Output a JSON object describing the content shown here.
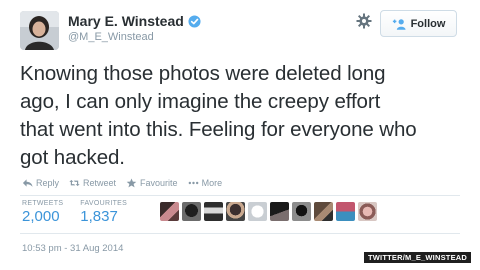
{
  "profile": {
    "display_name": "Mary E. Winstead",
    "handle": "@M_E_Winstead",
    "verified": true
  },
  "follow_button": {
    "label": "Follow"
  },
  "tweet": {
    "text_lines": [
      "Knowing those photos were deleted long",
      "ago, I can only imagine the creepy effort",
      "that went into this. Feeling for everyone who",
      "got hacked."
    ]
  },
  "actions": {
    "reply": "Reply",
    "retweet": "Retweet",
    "favourite": "Favourite",
    "more": "More"
  },
  "stats": {
    "retweets_label": "RETWEETS",
    "retweets_value": "2,000",
    "favourites_label": "FAVOURITES",
    "favourites_value": "1,837"
  },
  "favouriter_avatars": [
    "avatar-1",
    "avatar-2",
    "avatar-3",
    "avatar-4",
    "avatar-5",
    "avatar-6",
    "avatar-7",
    "avatar-8",
    "avatar-9",
    "avatar-10"
  ],
  "timestamp": "10:53 pm - 31 Aug 2014",
  "image_credit": "TWITTER/M_E_WINSTEAD",
  "colors": {
    "link_blue": "#3b94d9",
    "muted_gray": "#8899a6",
    "text": "#292f33"
  }
}
